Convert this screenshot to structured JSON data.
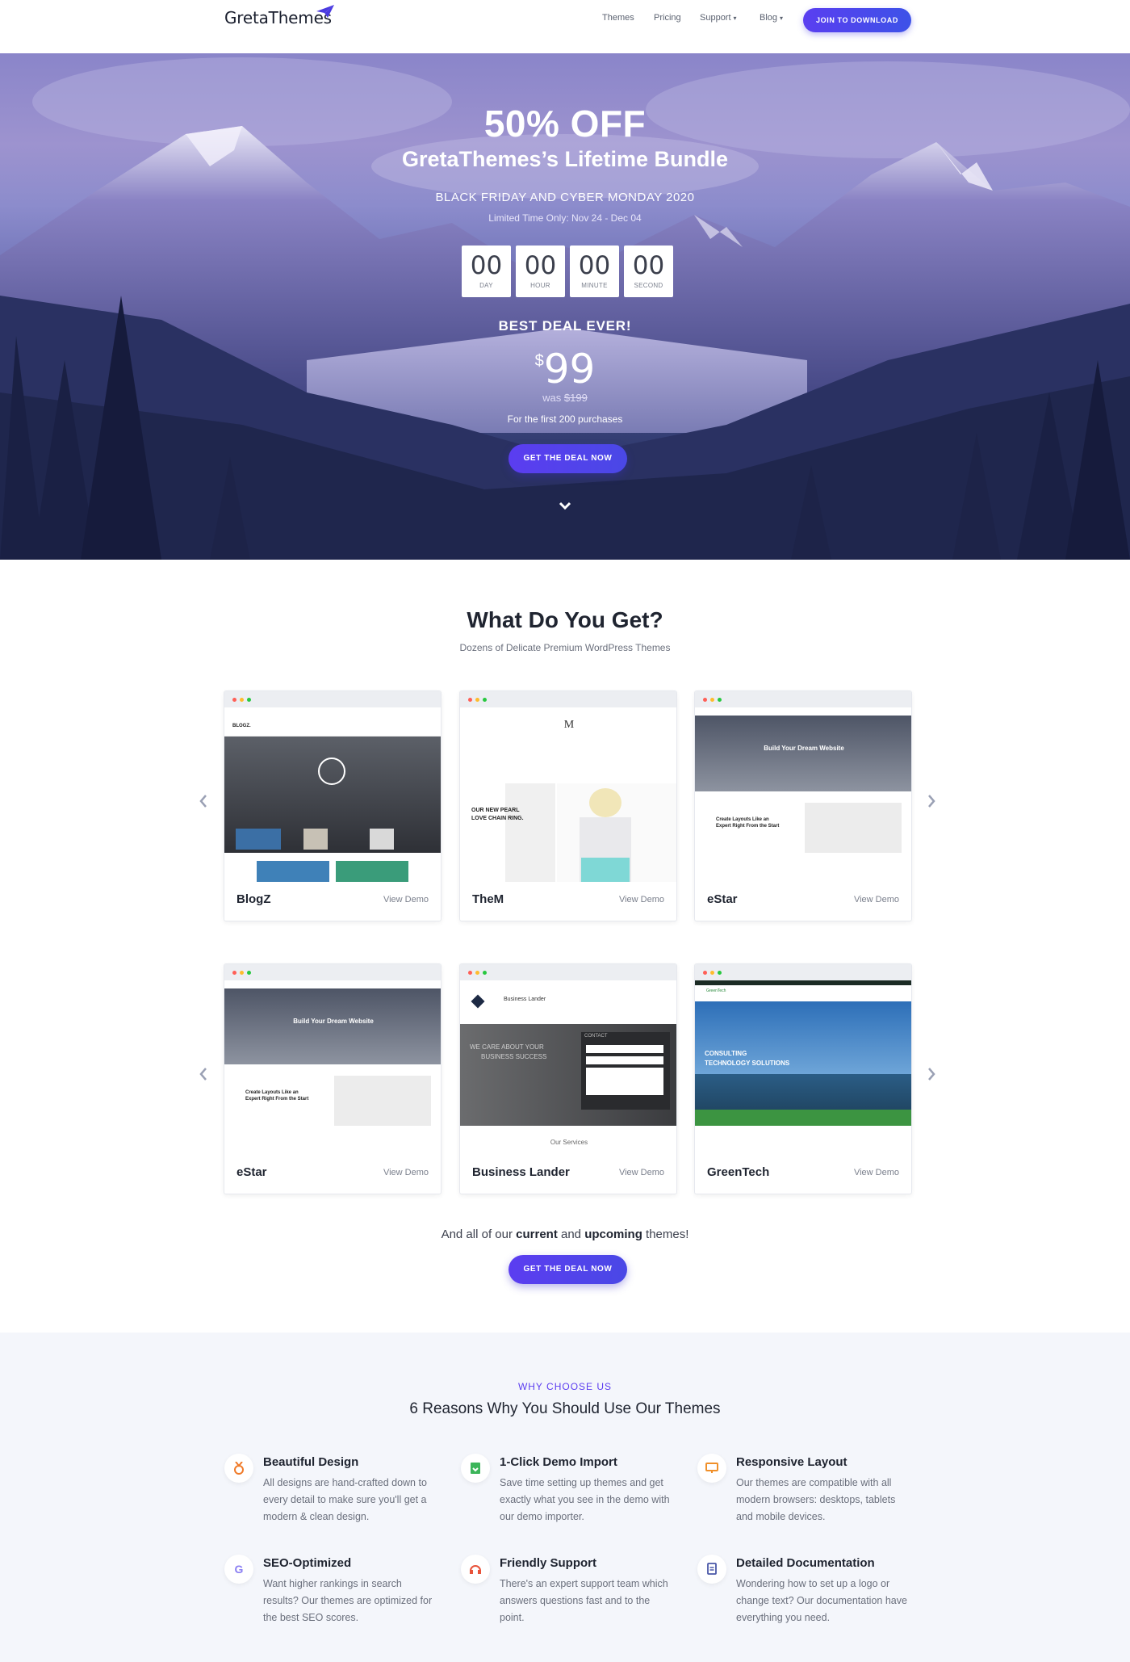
{
  "header": {
    "logo": "GretaThemes",
    "nav": [
      {
        "label": "Themes"
      },
      {
        "label": "Pricing"
      },
      {
        "label": "Support"
      },
      {
        "label": "Blog"
      }
    ],
    "cta": "JOIN TO DOWNLOAD"
  },
  "hero": {
    "discount": "50% OFF",
    "bundle": "GretaThemes’s Lifetime Bundle",
    "event": "BLACK FRIDAY AND CYBER MONDAY 2020",
    "limited": "Limited Time Only: Nov 24 - Dec 04",
    "countdown": [
      {
        "value": "00",
        "label": "DAY"
      },
      {
        "value": "00",
        "label": "HOUR"
      },
      {
        "value": "00",
        "label": "MINUTE"
      },
      {
        "value": "00",
        "label": "SECOND"
      }
    ],
    "best_deal": "BEST DEAL EVER!",
    "currency": "$",
    "price": "99",
    "was_label": "was",
    "was_price": "$199",
    "first_purchases": "For the first 200 purchases",
    "cta": "GET THE DEAL NOW"
  },
  "themes_section": {
    "title": "What Do You Get?",
    "subtitle": "Dozens of Delicate Premium WordPress Themes",
    "view_demo": "View Demo",
    "row1": [
      {
        "name": "BlogZ"
      },
      {
        "name": "TheM"
      },
      {
        "name": "eStar"
      }
    ],
    "row2": [
      {
        "name": "eStar"
      },
      {
        "name": "Business Lander"
      },
      {
        "name": "GreenTech"
      }
    ],
    "shots": {
      "blogz_brand": "BLOGZ.",
      "them_logo": "M",
      "them_headline_1": "OUR NEW PEARL",
      "them_headline_2": "LOVE CHAIN RING.",
      "estar_hero": "Build Your Dream Website",
      "estar_sub_1": "Create Layouts Like an",
      "estar_sub_2": "Expert Right From the Start",
      "bl_brand": "Business Lander",
      "bl_hero_1": "WE CARE ABOUT YOUR",
      "bl_hero_2": "BUSINESS SUCCESS",
      "bl_contact": "CONTACT",
      "bl_services": "Our Services",
      "gt_brand": "GreenTech",
      "gt_hero_1": "CONSULTING",
      "gt_hero_2": "TECHNOLOGY SOLUTIONS"
    },
    "and_all_pre": "And all of our ",
    "and_all_current": "current",
    "and_all_mid": " and ",
    "and_all_upcoming": "upcoming",
    "and_all_post": " themes!",
    "cta": "GET THE DEAL NOW"
  },
  "reasons": {
    "eyebrow": "WHY CHOOSE US",
    "title": "6 Reasons Why You Should Use Our Themes",
    "items": [
      {
        "icon": "medal-icon",
        "title": "Beautiful Design",
        "desc": "All designs are hand-crafted down to every detail to make sure you'll get a modern & clean design."
      },
      {
        "icon": "import-icon",
        "title": "1-Click Demo Import",
        "desc": "Save time setting up themes and get exactly what you see in the demo with our demo importer."
      },
      {
        "icon": "monitor-icon",
        "title": "Responsive Layout",
        "desc": "Our themes are compatible with all modern browsers: desktops, tablets and mobile devices."
      },
      {
        "icon": "google-icon",
        "title": "SEO-Optimized",
        "desc": "Want higher rankings in search results? Our themes are optimized for the best SEO scores."
      },
      {
        "icon": "headset-icon",
        "title": "Friendly Support",
        "desc": "There's an expert support team which answers questions fast and to the point."
      },
      {
        "icon": "document-icon",
        "title": "Detailed Documentation",
        "desc": "Wondering how to set up a logo or change text? Our documentation have everything you need."
      }
    ]
  },
  "colors": {
    "accent": "#5b3df0",
    "dark": "#1f2430",
    "bg_light": "#f4f6fb"
  }
}
